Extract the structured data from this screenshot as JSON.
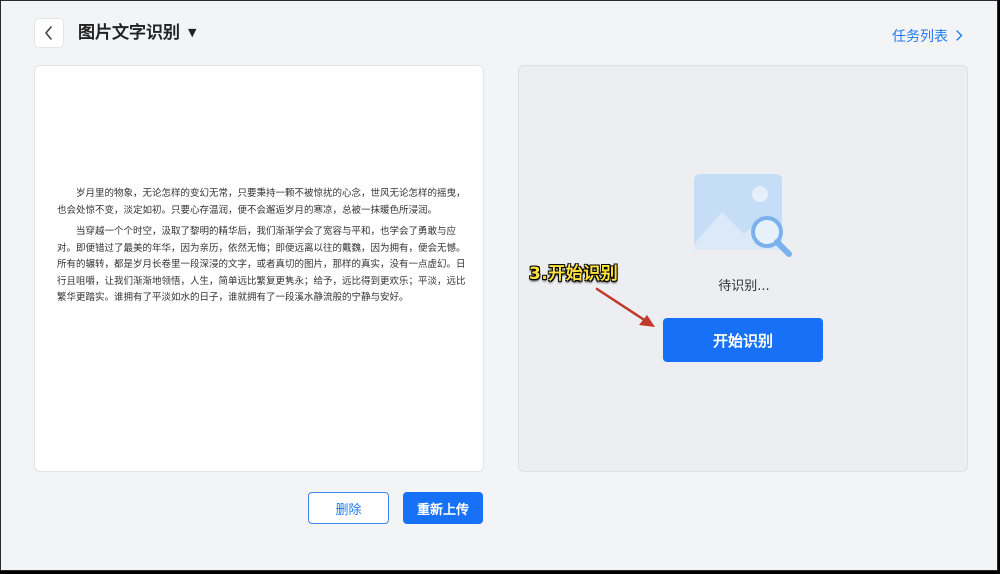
{
  "header": {
    "title": "图片文字识别",
    "task_list_label": "任务列表",
    "back_icon": "chevron-left-icon",
    "dropdown_icon": "caret-down-icon",
    "task_list_icon": "chevron-right-icon"
  },
  "document": {
    "paragraphs": [
      "岁月里的物象，无论怎样的变幻无常，只要秉持一颗不被惊扰的心念，世风无论怎样的摇曳，也会处惊不变，淡定如初。只要心存温润，便不会邂逅岁月的寒凉，总被一抹暖色所浸润。",
      "当穿越一个个时空，汲取了黎明的精华后，我们渐渐学会了宽容与平和，也学会了勇敢与应对。即便错过了最美的年华，因为亲历，依然无悔；即便远离以往的戴魏，因为拥有，便会无憾。所有的辗转，都是岁月长卷里一段深浸的文字，或者真切的图片，那样的真实，没有一点虚幻。日行且咀嚼，让我们渐渐地领悟，人生，简单远比繁复更隽永；给予，远比得到更欢乐；平淡，远比繁华更踏实。谁拥有了平淡如水的日子，谁就拥有了一段溪水静流般的宁静与安好。"
    ]
  },
  "recognition": {
    "pending_text": "待识别...",
    "start_button": "开始识别",
    "image_icon": "image-search-icon"
  },
  "annotation": {
    "label": "3.开始识别"
  },
  "actions": {
    "delete_label": "删除",
    "reupload_label": "重新上传"
  },
  "colors": {
    "primary": "#1671f7",
    "link": "#1f7af0",
    "annotation": "#ffe23a",
    "arrow": "#c0392b"
  }
}
